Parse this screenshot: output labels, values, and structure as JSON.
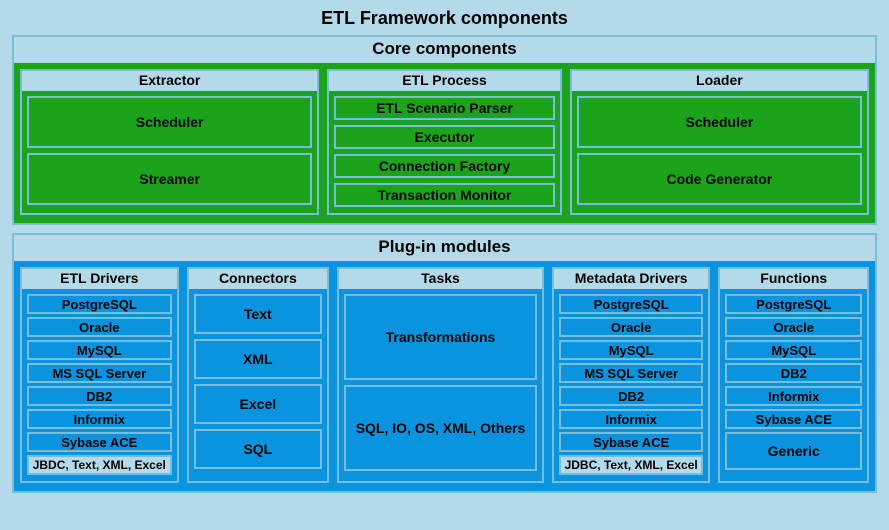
{
  "title": "ETL Framework components",
  "core": {
    "title": "Core components",
    "extractor": {
      "title": "Extractor",
      "items": [
        "Scheduler",
        "Streamer"
      ]
    },
    "etlprocess": {
      "title": "ETL Process",
      "items": [
        "ETL Scenario Parser",
        "Executor",
        "Connection Factory",
        "Transaction Monitor"
      ]
    },
    "loader": {
      "title": "Loader",
      "items": [
        "Scheduler",
        "Code Generator"
      ]
    }
  },
  "plugin": {
    "title": "Plug-in modules",
    "etldrivers": {
      "title": "ETL Drivers",
      "items": [
        "PostgreSQL",
        "Oracle",
        "MySQL",
        "MS SQL Server",
        "DB2",
        "Informix",
        "Sybase ACE",
        "JBDC, Text, XML, Excel"
      ]
    },
    "connectors": {
      "title": "Connectors",
      "items": [
        "Text",
        "XML",
        "Excel",
        "SQL"
      ]
    },
    "tasks": {
      "title": "Tasks",
      "items": [
        "Transformations",
        "SQL, IO, OS, XML, Others"
      ]
    },
    "metadata": {
      "title": "Metadata Drivers",
      "items": [
        "PostgreSQL",
        "Oracle",
        "MySQL",
        "MS SQL Server",
        "DB2",
        "Informix",
        "Sybase ACE",
        "JDBC, Text, XML, Excel"
      ]
    },
    "functions": {
      "title": "Functions",
      "items": [
        "PostgreSQL",
        "Oracle",
        "MySQL",
        "DB2",
        "Informix",
        "Sybase ACE",
        "Generic"
      ]
    }
  }
}
